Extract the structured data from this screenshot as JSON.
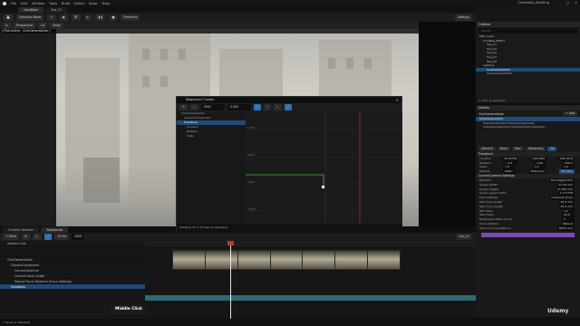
{
  "app": {
    "menu": [
      "File",
      "Edit",
      "Window",
      "Tools",
      "Build",
      "Select",
      "Actor",
      "Help"
    ],
    "project": "Cinematic_Building",
    "tabs": [
      "CamMain",
      "Seq_01"
    ]
  },
  "toolbar": {
    "mode_label": "Selection Mode",
    "platforms": "Platforms",
    "settings": "Settings"
  },
  "viewport": {
    "perspective": "Perspective",
    "lit": "Lit",
    "show": "Show",
    "pilot": "[ Pilot Active - CineCameraActor ]"
  },
  "outliner": {
    "title": "Outliner",
    "search_placeholder": "Search...",
    "items": [
      "Main Level",
      "CineMap_BP001",
      "Seq_01",
      "Seq_02",
      "Seq_03",
      "Seq_04",
      "Seq_05",
      "Lighting",
      "CineCameraActor",
      "CineCameraActor2"
    ],
    "count": "1 Actor (1 selected)"
  },
  "details": {
    "title": "Details",
    "actor": "CineCameraActor",
    "add": "+ Add",
    "components": [
      "CineCameraActor",
      "SceneComponent (SceneComponent)",
      "CameraComponent (CineCameraComponent)"
    ],
    "filter_tabs": [
      "General",
      "Actor",
      "Misc",
      "Streaming",
      "All"
    ],
    "sections": [
      {
        "name": "Transform",
        "rows": [
          [
            "Location",
            "25.97754",
            "140.5362",
            "192.2514"
          ],
          [
            "Rotation",
            "0.0",
            "-3.99",
            "-150.0"
          ],
          [
            "Scale",
            "1.0",
            "1.0",
            "1.0"
          ],
          [
            "Mobility",
            "Static",
            "Stationary",
            "Movable"
          ]
        ]
      },
      {
        "name": "Current Camera Settings",
        "rows": [
          [
            "Filmback",
            "16:9 Digital Film",
            ""
          ],
          [
            "Sensor Width",
            "23.76 mm",
            ""
          ],
          [
            "Sensor Height",
            "13.365 mm",
            ""
          ],
          [
            "Sensor Aspect Ratio",
            "1.777778",
            ""
          ],
          [
            "Lens Settings",
            "Universal Zoom",
            ""
          ],
          [
            "Min Focal Length",
            "35.0 mm",
            ""
          ],
          [
            "Max Focal Length",
            "35.0 mm",
            ""
          ],
          [
            "Min FStop",
            "1.2",
            ""
          ],
          [
            "Max FStop",
            "22.0",
            ""
          ],
          [
            "Diaphragm Blade Count",
            "7",
            ""
          ],
          [
            "Focus Method",
            "Manual",
            ""
          ],
          [
            "Manual Focus Distance",
            "300.0 mm",
            ""
          ]
        ]
      }
    ]
  },
  "curves": {
    "title": "Sequencer Curves",
    "tree": [
      "CineCameraActor",
      "CameraComponent",
      "Transform",
      "Location",
      "Rotation",
      "Scale"
    ],
    "frame_field": "0000",
    "time_field": "0.000",
    "status": "Showing 75 of 75 keys (1 selected)",
    "y_labels": [
      "1.000",
      "0.500",
      "0.000",
      "-0.500"
    ]
  },
  "sequencer": {
    "tabs": [
      "Content Browser",
      "Sequencer"
    ],
    "track_button": "+ Track",
    "fps": "30 fps",
    "time": "0000",
    "end_time": "Sub_01",
    "tracks": [
      "Camera Cuts",
      "CineCameraActor",
      "CameraComponent",
      "Current Aperture",
      "Current Focal Length",
      "Manual Focus Distance (Focus Settings)",
      "Transform"
    ],
    "status": "7 items (1 selected)"
  },
  "hint": "Middle Click",
  "watermark": "Udemy"
}
